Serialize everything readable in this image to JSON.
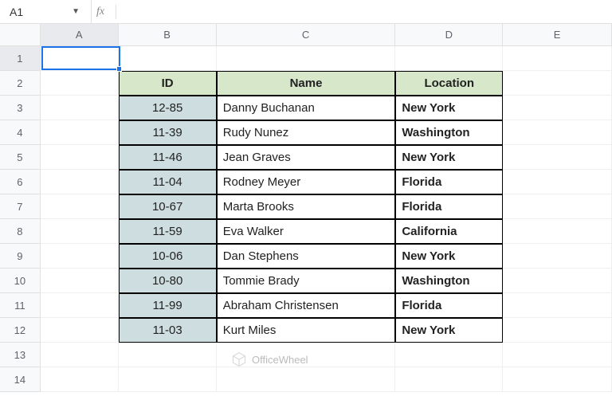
{
  "nameBox": "A1",
  "formula": "",
  "columns": [
    "A",
    "B",
    "C",
    "D",
    "E"
  ],
  "rowNumbers": [
    "1",
    "2",
    "3",
    "4",
    "5",
    "6",
    "7",
    "8",
    "9",
    "10",
    "11",
    "12",
    "13",
    "14"
  ],
  "table": {
    "headers": {
      "id": "ID",
      "name": "Name",
      "location": "Location"
    },
    "rows": [
      {
        "id": "12-85",
        "name": "Danny Buchanan",
        "location": "New York"
      },
      {
        "id": "11-39",
        "name": "Rudy Nunez",
        "location": "Washington"
      },
      {
        "id": "11-46",
        "name": "Jean Graves",
        "location": "New York"
      },
      {
        "id": "11-04",
        "name": "Rodney Meyer",
        "location": "Florida"
      },
      {
        "id": "10-67",
        "name": "Marta Brooks",
        "location": "Florida"
      },
      {
        "id": "11-59",
        "name": "Eva Walker",
        "location": "California"
      },
      {
        "id": "10-06",
        "name": "Dan Stephens",
        "location": "New York"
      },
      {
        "id": "10-80",
        "name": "Tommie Brady",
        "location": "Washington"
      },
      {
        "id": "11-99",
        "name": "Abraham Christensen",
        "location": "Florida"
      },
      {
        "id": "11-03",
        "name": "Kurt Miles",
        "location": "New York"
      }
    ]
  },
  "watermark": "OfficeWheel"
}
